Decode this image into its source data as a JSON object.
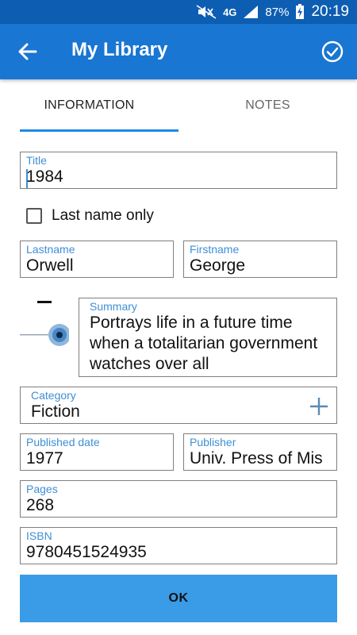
{
  "status_bar": {
    "network": "4G",
    "battery": "87%",
    "time": "20:19"
  },
  "app_bar": {
    "title": "My Library"
  },
  "tabs": [
    {
      "label": "INFORMATION",
      "active": true
    },
    {
      "label": "NOTES",
      "active": false
    }
  ],
  "form": {
    "title": {
      "label": "Title",
      "value": "1984"
    },
    "last_name_only": {
      "label": "Last name only",
      "checked": false
    },
    "lastname": {
      "label": "Lastname",
      "value": "Orwell"
    },
    "firstname": {
      "label": "Firstname",
      "value": "George"
    },
    "summary": {
      "label": "Summary",
      "value": "Portrays life in a future time when a totalitarian government watches over all"
    },
    "category": {
      "label": "Category",
      "value": "Fiction"
    },
    "published_date": {
      "label": "Published date",
      "value": "1977"
    },
    "publisher": {
      "label": "Publisher",
      "value": "Univ. Press of Mis"
    },
    "pages": {
      "label": "Pages",
      "value": "268"
    },
    "isbn": {
      "label": "ISBN",
      "value": "9780451524935"
    }
  },
  "ok_button": {
    "label": "OK"
  },
  "colors": {
    "status_bar": "#0d5eb3",
    "app_bar": "#1976d2",
    "accent": "#1e88e5",
    "label": "#3f8fd6",
    "ok_button": "#3a9be6"
  }
}
